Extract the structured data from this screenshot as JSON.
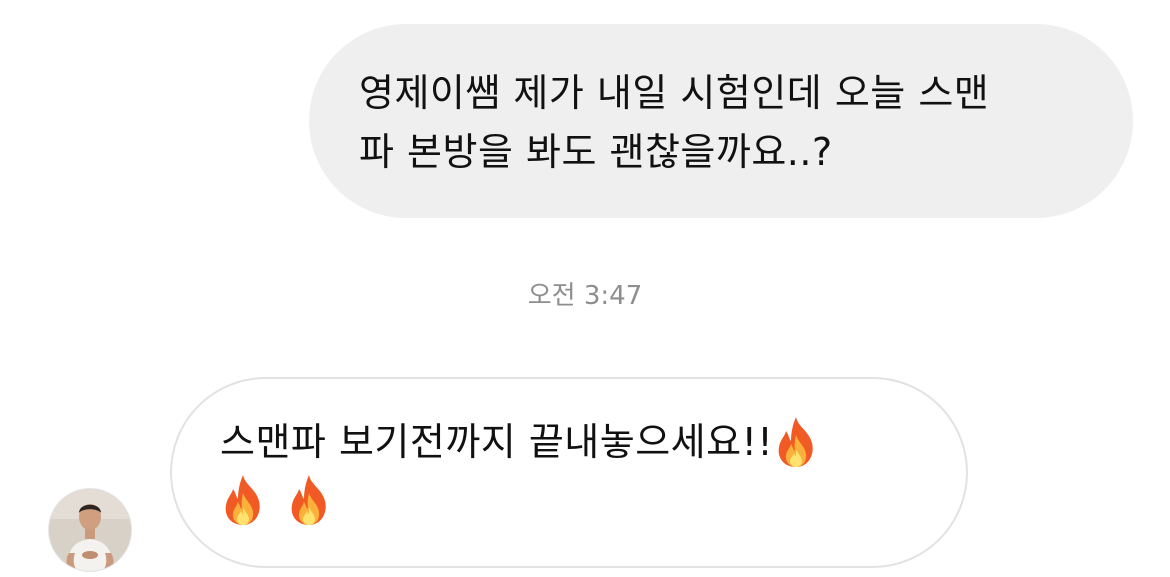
{
  "conversation": {
    "outgoing_message": {
      "lines": [
        "영제이쌤 제가 내일 시험인데 오늘 스맨",
        "파 본방을 봐도 괜찮을까요..?"
      ]
    },
    "timestamp": "오전 3:47",
    "incoming_message": {
      "text": "스맨파 보기전까지 끝내놓으세요!!",
      "emoji": [
        "fire-emoji",
        "fire-emoji",
        "fire-emoji"
      ]
    },
    "sender_avatar": "profile-photo"
  },
  "colors": {
    "outgoing_bubble": "#efefef",
    "incoming_bubble_border": "#e2e2e2",
    "timestamp_text": "#8e8e8e",
    "message_text": "#111111"
  }
}
